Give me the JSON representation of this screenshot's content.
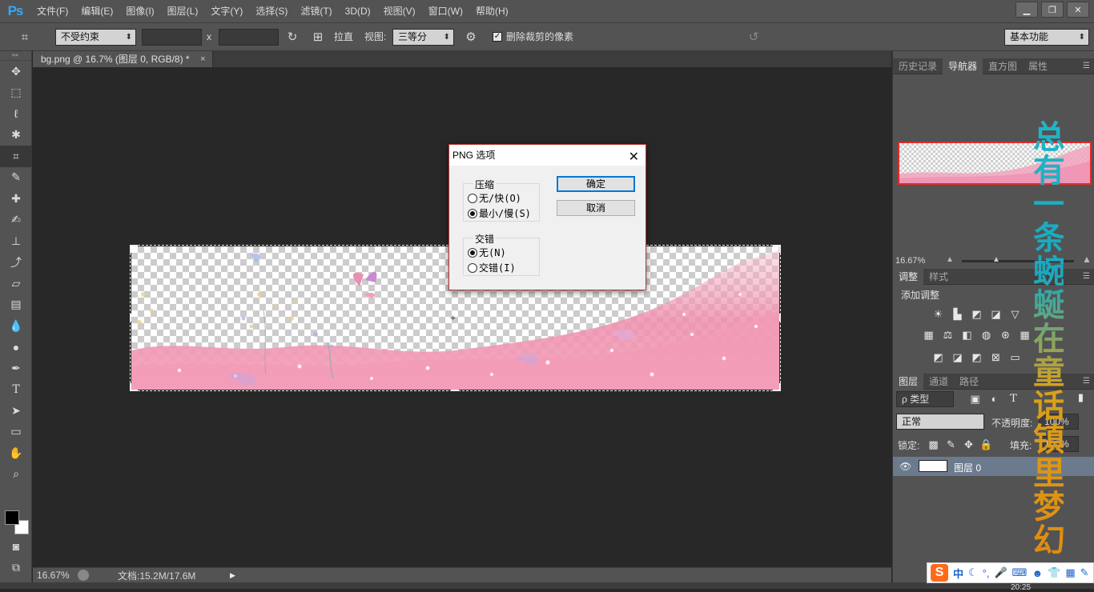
{
  "app": {
    "logo": "Ps",
    "menu": [
      "文件(F)",
      "编辑(E)",
      "图像(I)",
      "图层(L)",
      "文字(Y)",
      "选择(S)",
      "滤镜(T)",
      "3D(D)",
      "视图(V)",
      "窗口(W)",
      "帮助(H)"
    ],
    "window_buttons": [
      "▁",
      "❐",
      "✕"
    ]
  },
  "options": {
    "ratio_select": "不受约束",
    "x_label": "x",
    "straighten_label": "拉直",
    "view_label": "视图:",
    "view_select": "三等分",
    "delete_pixels_label": "删除裁剪的像素",
    "delete_pixels_checked": true,
    "workspace_select": "基本功能"
  },
  "document": {
    "tab_title": "bg.png @ 16.7% (图层 0, RGB/8) *",
    "tab_close": "×",
    "status_zoom": "16.67%",
    "status_doc": "文档:15.2M/17.6M"
  },
  "dialog": {
    "title": "PNG 选项",
    "close": "✕",
    "compression_group": "压缩",
    "compression_options": [
      {
        "label": "无/快(O)",
        "checked": false
      },
      {
        "label": "最小/慢(S)",
        "checked": true
      }
    ],
    "interlace_group": "交错",
    "interlace_options": [
      {
        "label": "无(N)",
        "checked": true
      },
      {
        "label": "交错(I)",
        "checked": false
      }
    ],
    "ok": "确定",
    "cancel": "取消"
  },
  "panels": {
    "top_tabs": [
      "历史记录",
      "导航器",
      "直方图",
      "属性"
    ],
    "top_active": "导航器",
    "nav_zoom": "16.67%",
    "adjust_tabs": [
      "调整",
      "样式"
    ],
    "adjust_active": "调整",
    "add_adjustment": "添加调整",
    "layer_tabs": [
      "图层",
      "通道",
      "路径"
    ],
    "layer_active": "图层",
    "filter_select": "ρ 类型",
    "blend_mode": "正常",
    "opacity_label": "不透明度:",
    "opacity_value": "100%",
    "lock_label": "锁定:",
    "fill_label": "填充:",
    "fill_value": "100%",
    "layer_name": "图层 0"
  },
  "overlay": {
    "vertical_text": "总有一条蜿蜒在童话镇里梦幻"
  },
  "ime": {
    "logo": "S",
    "mode": "中"
  },
  "clock": "20:25",
  "colors": {
    "ps_blue": "#31a8ff",
    "panel_gray": "#535353",
    "canvas_bg": "#282828",
    "dialog_border": "#b33333",
    "thumb_border": "#e02b2b"
  }
}
